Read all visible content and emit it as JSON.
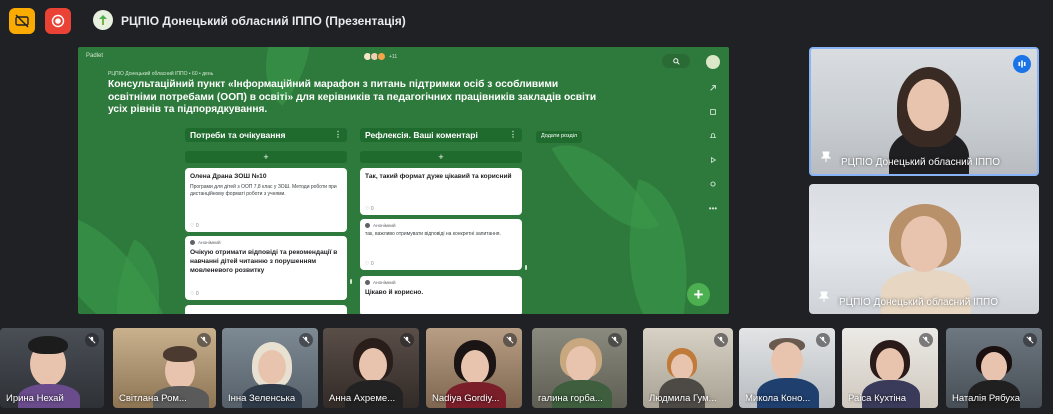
{
  "meeting": {
    "title": "РЦПІО Донецький обласний ІППО (Презентація)"
  },
  "toolbar": {
    "left_buttons": [
      {
        "icon": "no-caption-icon",
        "color": "#f9ab00"
      },
      {
        "icon": "stop-present-icon",
        "color": "#ea4335"
      }
    ]
  },
  "presentation": {
    "brand": "Padlet",
    "collaborators_more": "+11",
    "breadcrumb": "РЦПІО Донецький обласний ІППО • 60 • день",
    "board_title": "Консультаційний пункт «Інформаційний марафон з питань підтримки осіб з особливими освітніми потребами (ООП) в освіті» для керівників та педагогічних працівників закладів освіти усіх рівнів та підпорядкування.",
    "add_section_label": "Додати розділ",
    "columns": [
      {
        "title": "Потреби та очікування",
        "cards": [
          {
            "author": "",
            "heading": "Олена Драна ЗОШ №10",
            "body": "Програми для дітей з ООП 7,8 клас у ЗОШ. Методи роботи при дистанційному форматі роботи з учнями.",
            "likes": "0"
          },
          {
            "author": "Анонімний",
            "heading": "Очікую отримати відповіді та рекомендації в навчанні дітей читанню з порушенням мовленевого розвитку",
            "body": "",
            "likes": "0"
          }
        ]
      },
      {
        "title": "Рефлексія.  Ваші коментарі",
        "cards": [
          {
            "author": "",
            "heading": "Так, такий формат дуже цікавий та корисний",
            "body": "",
            "likes": "0"
          },
          {
            "author": "Анонімний",
            "heading": "",
            "body": "так, важливо отримувати відповіді на конкретні запитання.",
            "likes": "0"
          },
          {
            "author": "Анонімний",
            "heading": "Цікаво й корисно.",
            "body": "",
            "likes": ""
          }
        ]
      }
    ]
  },
  "speakers": [
    {
      "name": "РЦПІО Донецький обласний ІППО",
      "speaking": true
    },
    {
      "name": "РЦПІО Донецький обласний ІППО",
      "speaking": false
    }
  ],
  "participants": [
    {
      "name": "Ирина Нехай",
      "muted": true
    },
    {
      "name": "Світлана Ром...",
      "muted": true
    },
    {
      "name": "Інна Зеленська",
      "muted": true
    },
    {
      "name": "Анна Ахреме...",
      "muted": true
    },
    {
      "name": "Nadiya Gordiy...",
      "muted": true
    },
    {
      "name": "галина горба...",
      "muted": true
    },
    {
      "name": "Людмила Гум...",
      "muted": true
    },
    {
      "name": "Микола Коно...",
      "muted": true
    },
    {
      "name": "Раіса Кухтіна",
      "muted": true
    },
    {
      "name": "Наталія Рябуха",
      "muted": true
    }
  ],
  "colors": {
    "background": "#202124",
    "padlet_green": "#2e7a3c",
    "active_speaker_border": "#8ab4f8",
    "fab": "#4caf50"
  }
}
